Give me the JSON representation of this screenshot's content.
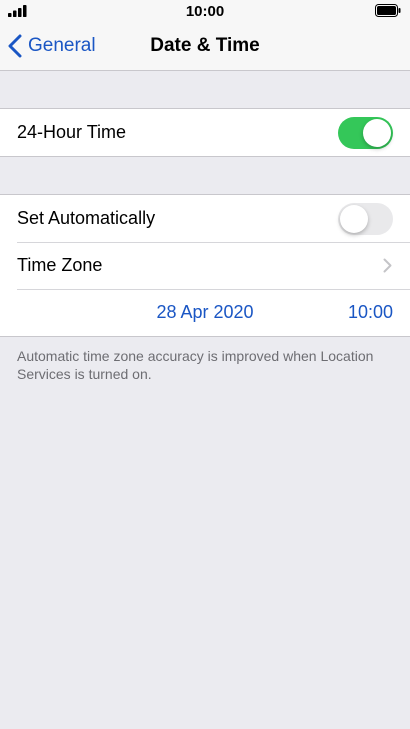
{
  "status_bar": {
    "time": "10:00",
    "signal_icon": "signal-bars-icon",
    "battery_icon": "battery-full-icon"
  },
  "nav": {
    "back_label": "General",
    "back_icon": "chevron-left-icon",
    "title": "Date & Time"
  },
  "settings": {
    "hour24": {
      "label": "24-Hour Time",
      "enabled": true
    },
    "set_automatically": {
      "label": "Set Automatically",
      "enabled": false
    },
    "time_zone": {
      "label": "Time Zone",
      "icon": "chevron-right-icon"
    },
    "date_time": {
      "date": "28 Apr 2020",
      "time": "10:00"
    }
  },
  "footnote": "Automatic time zone accuracy is improved when Location Services is turned on.",
  "colors": {
    "accent": "#1a56c4",
    "toggle_on": "#34c759",
    "toggle_off": "#e9e9eb",
    "background": "#ebebf0"
  }
}
